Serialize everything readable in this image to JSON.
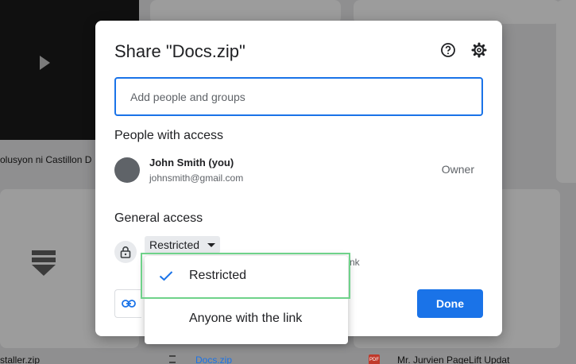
{
  "background": {
    "file1_name": "olusyon ni Castillon D",
    "file2_name": "staller.zip",
    "file3_name": "Docs.zip",
    "file4_name": "Mr. Jurvien PageLift Updat",
    "pdf_badge": "PDF"
  },
  "dialog": {
    "title": "Share \"Docs.zip\"",
    "help_icon": "help-circle-icon",
    "settings_icon": "gear-icon",
    "search_placeholder": "Add people and groups",
    "people_section_title": "People with access",
    "person": {
      "name": "John Smith (you)",
      "email": "johnsmith@gmail.com",
      "role": "Owner"
    },
    "general_access_title": "General access",
    "access_value": "Restricted",
    "partial_text": "nk",
    "done_label": "Done"
  },
  "menu": {
    "options": [
      {
        "label": "Restricted",
        "selected": true
      },
      {
        "label": "Anyone with the link",
        "selected": false
      }
    ]
  },
  "colors": {
    "accent": "#1a73e8",
    "highlight": "#6fd28a"
  }
}
